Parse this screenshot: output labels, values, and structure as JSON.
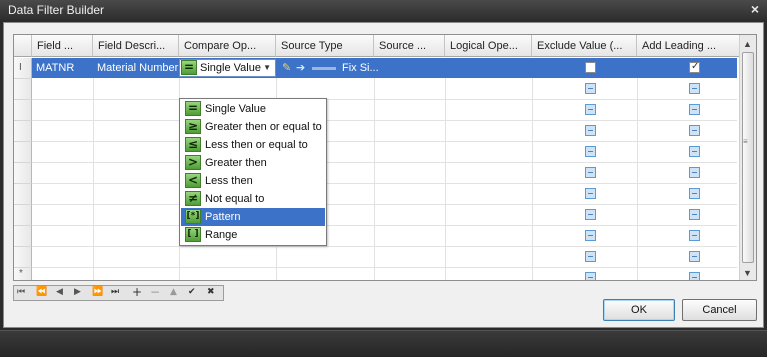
{
  "window": {
    "title": "Data Filter Builder",
    "close_glyph": "×"
  },
  "grid": {
    "columns": [
      "Field ...",
      "Field Descri...",
      "Compare Op...",
      "Source Type",
      "Source ...",
      "Logical Ope...",
      "Exclude Value (...",
      "Add Leading ..."
    ],
    "row": {
      "indicator": "I",
      "field": "MATNR",
      "description": "Material Number",
      "compare": "Single Value",
      "source_type": "Fix Si...",
      "exclude_value": false,
      "add_leading": true
    },
    "new_row_indicator": "*"
  },
  "dropdown": {
    "selected": "Pattern",
    "options": [
      {
        "symbol": "=",
        "label": "Single Value"
      },
      {
        "symbol": "≥",
        "label": "Greater then or equal to"
      },
      {
        "symbol": "≤",
        "label": "Less then or equal to"
      },
      {
        "symbol": ">",
        "label": "Greater then"
      },
      {
        "symbol": "<",
        "label": "Less then"
      },
      {
        "symbol": "≠",
        "label": "Not equal to"
      },
      {
        "symbol": "[*]",
        "label": "Pattern"
      },
      {
        "symbol": "[ ]",
        "label": "Range"
      }
    ]
  },
  "navigator": [
    "⏮",
    "⏪",
    "◀",
    "▶",
    "⏩",
    "⏭",
    "+",
    "−",
    "▲",
    "✔",
    "✖"
  ],
  "buttons": {
    "ok": "OK",
    "cancel": "Cancel"
  },
  "colors": {
    "selection": "#3d72c9",
    "icon_green": "#5aa840",
    "title_bar": "#3a3a3a"
  }
}
